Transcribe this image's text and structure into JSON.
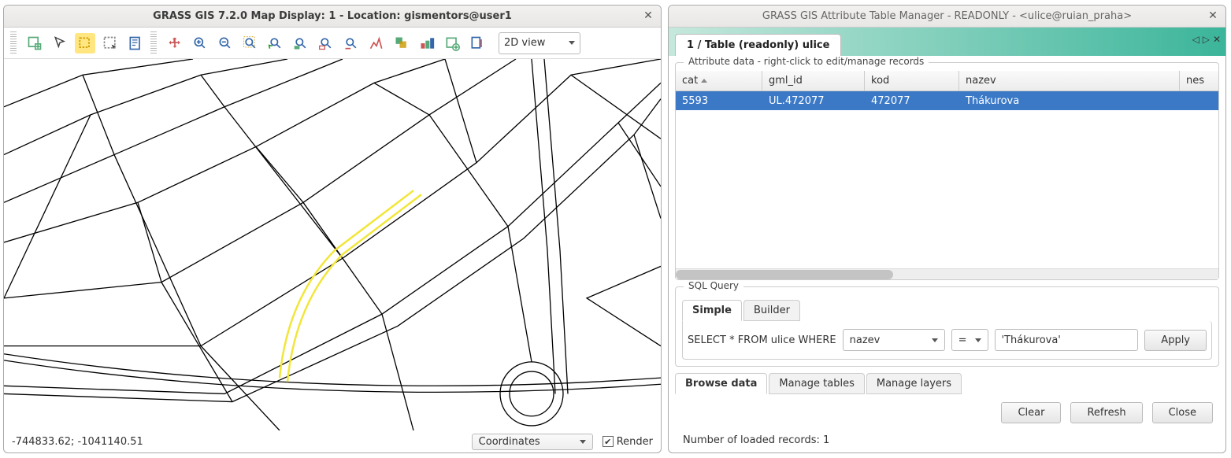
{
  "map_window": {
    "title": "GRASS GIS 7.2.0 Map Display: 1 - Location: gismentors@user1",
    "view_mode": "2D view",
    "coordinates": "-744833.62; -1041140.51",
    "coord_mode_label": "Coordinates",
    "render_label": "Render",
    "render_checked": true,
    "toolbar_icons": [
      "add-map-icon",
      "pointer-icon",
      "select-icon",
      "select-region-icon",
      "info-icon",
      "pan-icon",
      "zoom-in-icon",
      "zoom-out-icon",
      "zoom-extent-icon",
      "zoom-back-icon",
      "zoom-layer-icon",
      "zoom-region-icon",
      "zoom-saved-icon",
      "analyze-icon",
      "overlay-icon",
      "save-view-icon",
      "print-icon",
      "settings-icon"
    ]
  },
  "attr_window": {
    "title": "GRASS GIS Attribute Table Manager - READONLY - <ulice@ruian_praha>",
    "tab_label": "1 / Table (readonly) ulice",
    "group_label": "Attribute data - right-click to edit/manage records",
    "columns": {
      "cat": "cat",
      "gml_id": "gml_id",
      "kod": "kod",
      "nazev": "nazev",
      "extra": "nes"
    },
    "rows": [
      {
        "cat": "5593",
        "gml_id": "UL.472077",
        "kod": "472077",
        "nazev": "Thákurova"
      }
    ],
    "sql": {
      "group_label": "SQL Query",
      "tabs": {
        "simple": "Simple",
        "builder": "Builder"
      },
      "prefix": "SELECT * FROM ulice WHERE",
      "column": "nazev",
      "operator": "=",
      "value": "'Thákurova'",
      "apply": "Apply"
    },
    "bottom_tabs": {
      "browse": "Browse data",
      "tables": "Manage tables",
      "layers": "Manage layers"
    },
    "buttons": {
      "clear": "Clear",
      "refresh": "Refresh",
      "close": "Close"
    },
    "status": "Number of loaded records: 1"
  }
}
